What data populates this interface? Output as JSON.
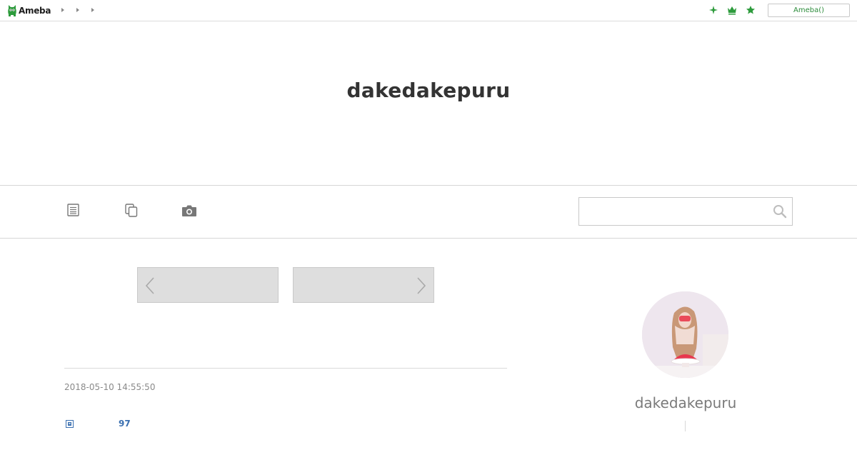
{
  "topbar": {
    "logo_text": "Ameba",
    "breadcrumb_count": 3,
    "button_label": "Ameba()"
  },
  "blog": {
    "title": "dakedakepuru"
  },
  "nav": {
    "icons": [
      "entry-list-icon",
      "theme-list-icon",
      "photo-camera-icon"
    ],
    "search_placeholder": ""
  },
  "pager": {
    "prev_label": "",
    "next_label": ""
  },
  "entry": {
    "date": "2018-05-10 14:55:50",
    "like_count": "97"
  },
  "profile": {
    "name": "dakedakepuru"
  },
  "colors": {
    "accent_green": "#2d8c3c",
    "link_blue": "#3a6fb0",
    "pager_gray": "#dedede"
  }
}
